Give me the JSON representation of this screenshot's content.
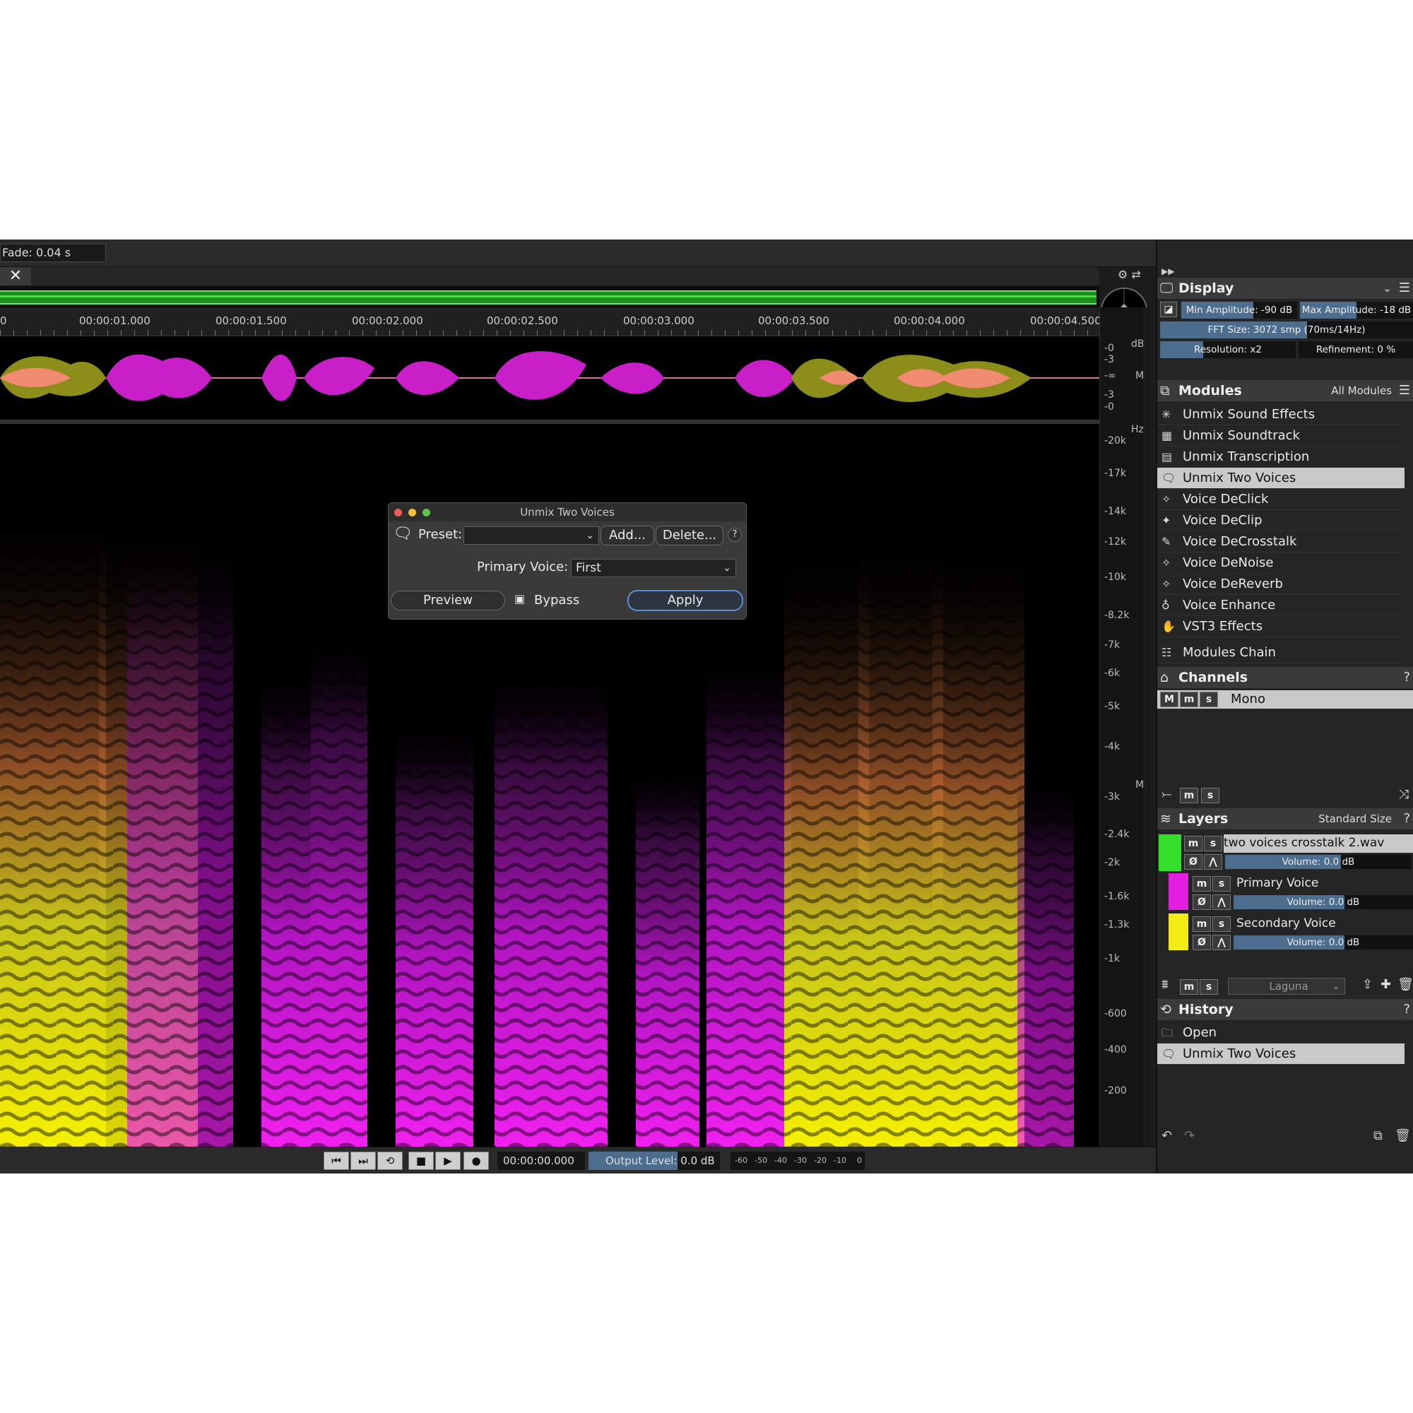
{
  "toolbar": {
    "fade": "Fade: 0.04 s",
    "close_label": "✕"
  },
  "ruler": {
    "labels": [
      "0",
      "00:00:01.000",
      "00:00:01.500",
      "00:00:02.000",
      "00:00:02.500",
      "00:00:03.000",
      "00:00:03.500",
      "00:00:04.000",
      "00:00:04.500"
    ]
  },
  "waveform_scale": {
    "unit": "dB",
    "labels": [
      "-0",
      "-3",
      "-∞",
      "-3",
      "-0"
    ],
    "channel": "M"
  },
  "freq_scale": {
    "unit": "Hz",
    "labels": [
      "-20k",
      "-17k",
      "-14k",
      "-12k",
      "-10k",
      "-8.2k",
      "-7k",
      "-6k",
      "-5k",
      "-4k",
      "-3k",
      "-2.4k",
      "-2k",
      "-1.6k",
      "-1.3k",
      "-1k",
      "-600",
      "-400",
      "-200"
    ],
    "channel": "M"
  },
  "dialog": {
    "title": "Unmix Two Voices",
    "preset_label": "Preset:",
    "preset_value": "",
    "add_label": "Add...",
    "delete_label": "Delete...",
    "help": "?",
    "primary_voice_label": "Primary Voice:",
    "primary_voice_value": "First",
    "preview_label": "Preview",
    "bypass_label": "Bypass",
    "apply_label": "Apply"
  },
  "transport": {
    "time": "00:00:00.000",
    "output_level": "Output Level: 0.0 dB",
    "output_fill": 0.68,
    "meter_labels": [
      "-60",
      "-50",
      "-40",
      "-30",
      "-20",
      "-10",
      "0"
    ]
  },
  "display": {
    "title": "Display",
    "min_amp": "Min Amplitude: -90 dB",
    "max_amp": "Max Amplitude: -18 dB",
    "fft": "FFT Size: 3072 smp (70ms/14Hz)",
    "resolution": "Resolution: x2",
    "refinement": "Refinement: 0 %"
  },
  "modules": {
    "title": "Modules",
    "filter": "All Modules",
    "items": [
      {
        "label": "Unmix Sound Effects"
      },
      {
        "label": "Unmix Soundtrack"
      },
      {
        "label": "Unmix Transcription"
      },
      {
        "label": "Unmix Two Voices"
      },
      {
        "label": "Voice DeClick"
      },
      {
        "label": "Voice DeClip"
      },
      {
        "label": "Voice DeCrosstalk"
      },
      {
        "label": "Voice DeNoise"
      },
      {
        "label": "Voice DeReverb"
      },
      {
        "label": "Voice Enhance"
      },
      {
        "label": "VST3 Effects"
      }
    ],
    "selected": "Unmix Two Voices",
    "chain": "Modules Chain"
  },
  "channels": {
    "title": "Channels",
    "items": [
      {
        "label": "Mono",
        "m": "M"
      }
    ],
    "help": "?"
  },
  "layers": {
    "title": "Layers",
    "size": "Standard Size",
    "help": "?",
    "items": [
      {
        "name": "two voices crosstalk 2.wav",
        "volume": "Volume: 0.0 dB",
        "color": "#35e02a"
      },
      {
        "name": "Primary Voice",
        "volume": "Volume: 0.0 dB",
        "color": "#e21fe0"
      },
      {
        "name": "Secondary Voice",
        "volume": "Volume: 0.0 dB",
        "color": "#f2ec14"
      }
    ],
    "blend": "Laguna"
  },
  "history": {
    "title": "History",
    "help": "?",
    "items": [
      {
        "label": "Open"
      },
      {
        "label": "Unmix Two Voices"
      }
    ],
    "selected": "Unmix Two Voices"
  },
  "buttons": {
    "m": "m",
    "s": "s"
  },
  "colors": {
    "primary": "#e21fe0",
    "secondary": "#f2ec14",
    "accent": "#4d6d8f"
  }
}
